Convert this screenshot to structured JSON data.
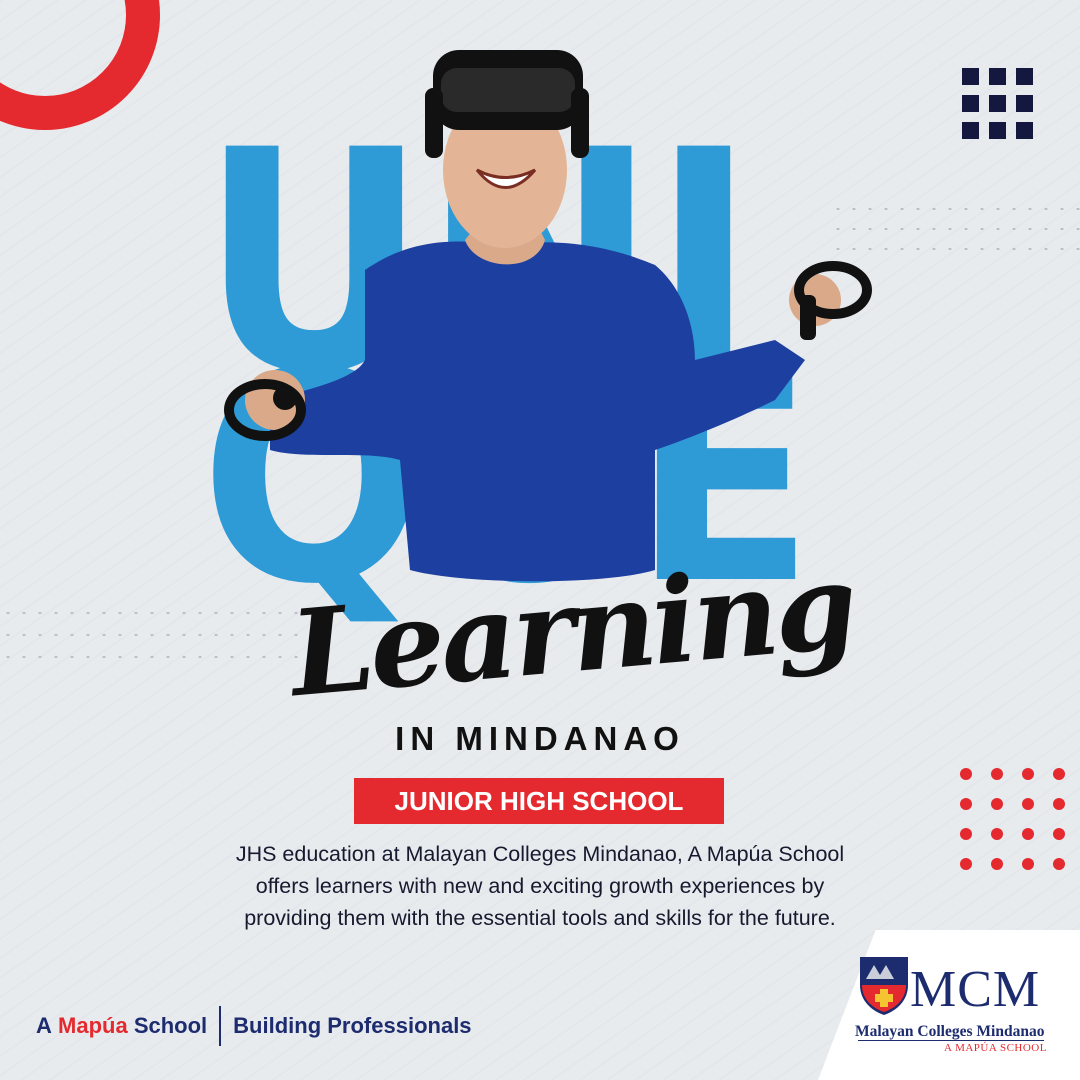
{
  "headline": {
    "line1": "UNI",
    "line2": "QUE",
    "script": "Learning",
    "subline": "IN MINDANAO"
  },
  "badge": {
    "label": "JUNIOR HIGH SCHOOL"
  },
  "description": "JHS education at Malayan Colleges Mindanao, A Mapúa School offers learners with new and exciting growth experiences by providing them with the essential tools and skills for the future.",
  "footer": {
    "prefix": "A",
    "brand": "Mapúa",
    "suffix": "School",
    "tagline": "Building Professionals"
  },
  "logo": {
    "acronym": "MCM",
    "name": "Malayan Colleges Mindanao",
    "subtitle": "A MAPÚA SCHOOL"
  },
  "colors": {
    "accent_red": "#e42a2f",
    "letter_blue": "#2e9ad6",
    "navy": "#1d2b6f",
    "shirt_blue": "#1c3fa0"
  },
  "illustration": {
    "subject": "smiling student wearing VR headset holding two VR controllers"
  }
}
